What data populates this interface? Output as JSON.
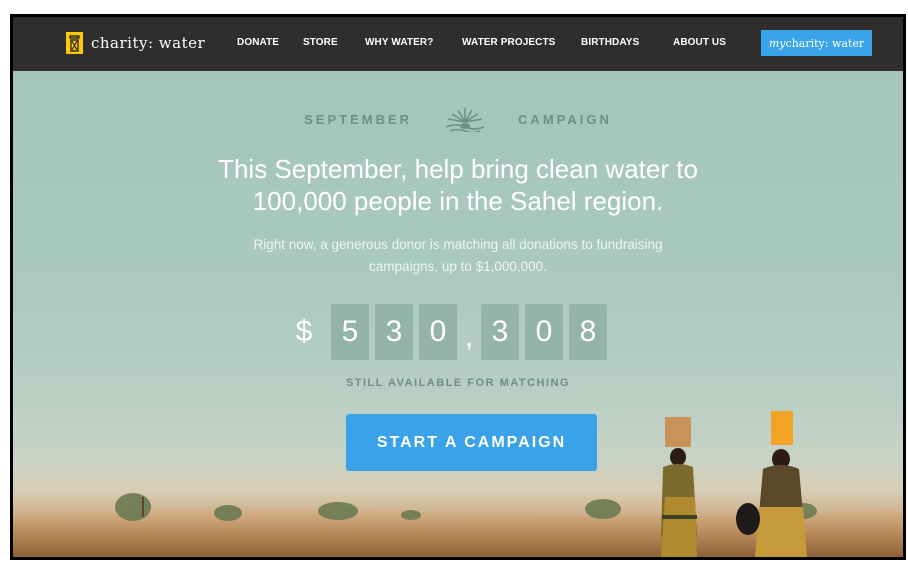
{
  "nav": {
    "logo_text": "charity: water",
    "items": [
      {
        "label": "DONATE"
      },
      {
        "label": "STORE"
      },
      {
        "label": "WHY WATER?"
      },
      {
        "label": "WATER PROJECTS"
      },
      {
        "label": "BIRTHDAYS"
      },
      {
        "label": "ABOUT US"
      }
    ],
    "mycharity_prefix": "my",
    "mycharity_suffix": "charity: water"
  },
  "hero": {
    "campaign_left": "SEPTEMBER",
    "campaign_right": "CAMPAIGN",
    "headline": "This September, help bring clean water to 100,000 people in the Sahel region.",
    "subtext": "Right now, a generous donor is matching all donations to fundraising campaigns, up to $1,000,000.",
    "counter": {
      "currency": "$",
      "digits": [
        "5",
        "3",
        "0",
        "3",
        "0",
        "8"
      ],
      "separator": ","
    },
    "counter_caption": "STILL AVAILABLE FOR MATCHING",
    "cta_label": "START A CAMPAIGN"
  },
  "colors": {
    "nav_bg": "#2f2e2c",
    "accent_blue": "#3aa2e8",
    "logo_yellow": "#ffc907",
    "sky": "#a4c4bb"
  },
  "icons": [
    "jerrycan-logo-icon",
    "sun-rays-icon"
  ]
}
